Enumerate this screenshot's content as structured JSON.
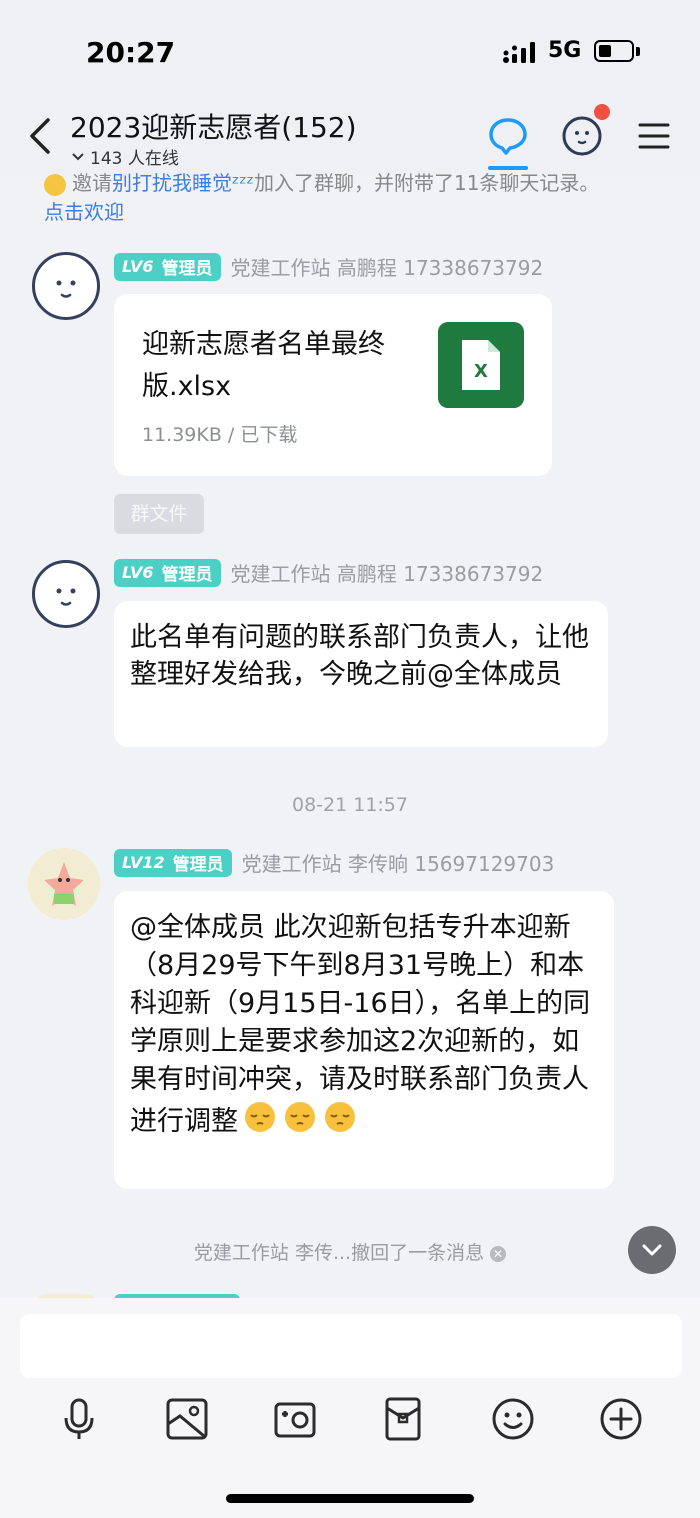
{
  "status_bar": {
    "time": "20:27",
    "network": "5G",
    "battery_level": 0.4
  },
  "header": {
    "title": "2023迎新志愿者(152)",
    "online": "143 人在线",
    "icons": [
      "back-arrow-icon",
      "chat-bubble-icon",
      "face-icon",
      "menu-icon"
    ],
    "accent": "#1e9bf7"
  },
  "system_notice": {
    "text_prefix": "邀请",
    "inviter": "别打扰我睡觉",
    "text_suffix": "加入了群聊，并附带了11条聊天记录。",
    "welcome": "点击欢迎"
  },
  "messages": [
    {
      "level": "LV6",
      "role": "管理员",
      "sender": "党建工作站 高鹏程 17338673792",
      "file": {
        "name": "迎新志愿者名单最终版.xlsx",
        "size": "11.39KB",
        "status": "已下载",
        "icon_label": "X"
      },
      "tag": "群文件"
    },
    {
      "level": "LV6",
      "role": "管理员",
      "sender": "党建工作站 高鹏程 17338673792",
      "text": "此名单有问题的联系部门负责人，让他整理好发给我，今晚之前@全体成员"
    },
    {
      "level": "LV12",
      "role": "管理员",
      "sender": "党建工作站 李传晌 15697129703",
      "text": "@全体成员 此次迎新包括专升本迎新（8月29号下午到8月31号晚上）和本科迎新（9月15日-16日），名单上的同学原则上是要求参加这2次迎新的，如果有时间冲突，请及时联系部门负责人进行调整"
    }
  ],
  "timestamp": "08-21 11:57",
  "recall_notice": "党建工作站 李传...撤回了一条消息",
  "composer": {
    "placeholder": "",
    "tools": [
      "microphone-icon",
      "image-icon",
      "camera-icon",
      "red-packet-icon",
      "emoji-icon",
      "plus-icon"
    ]
  },
  "colors": {
    "badge": "#4cd0c5",
    "link": "#3b7ee6",
    "excel": "#1e7a3e",
    "notification": "#f25141"
  }
}
